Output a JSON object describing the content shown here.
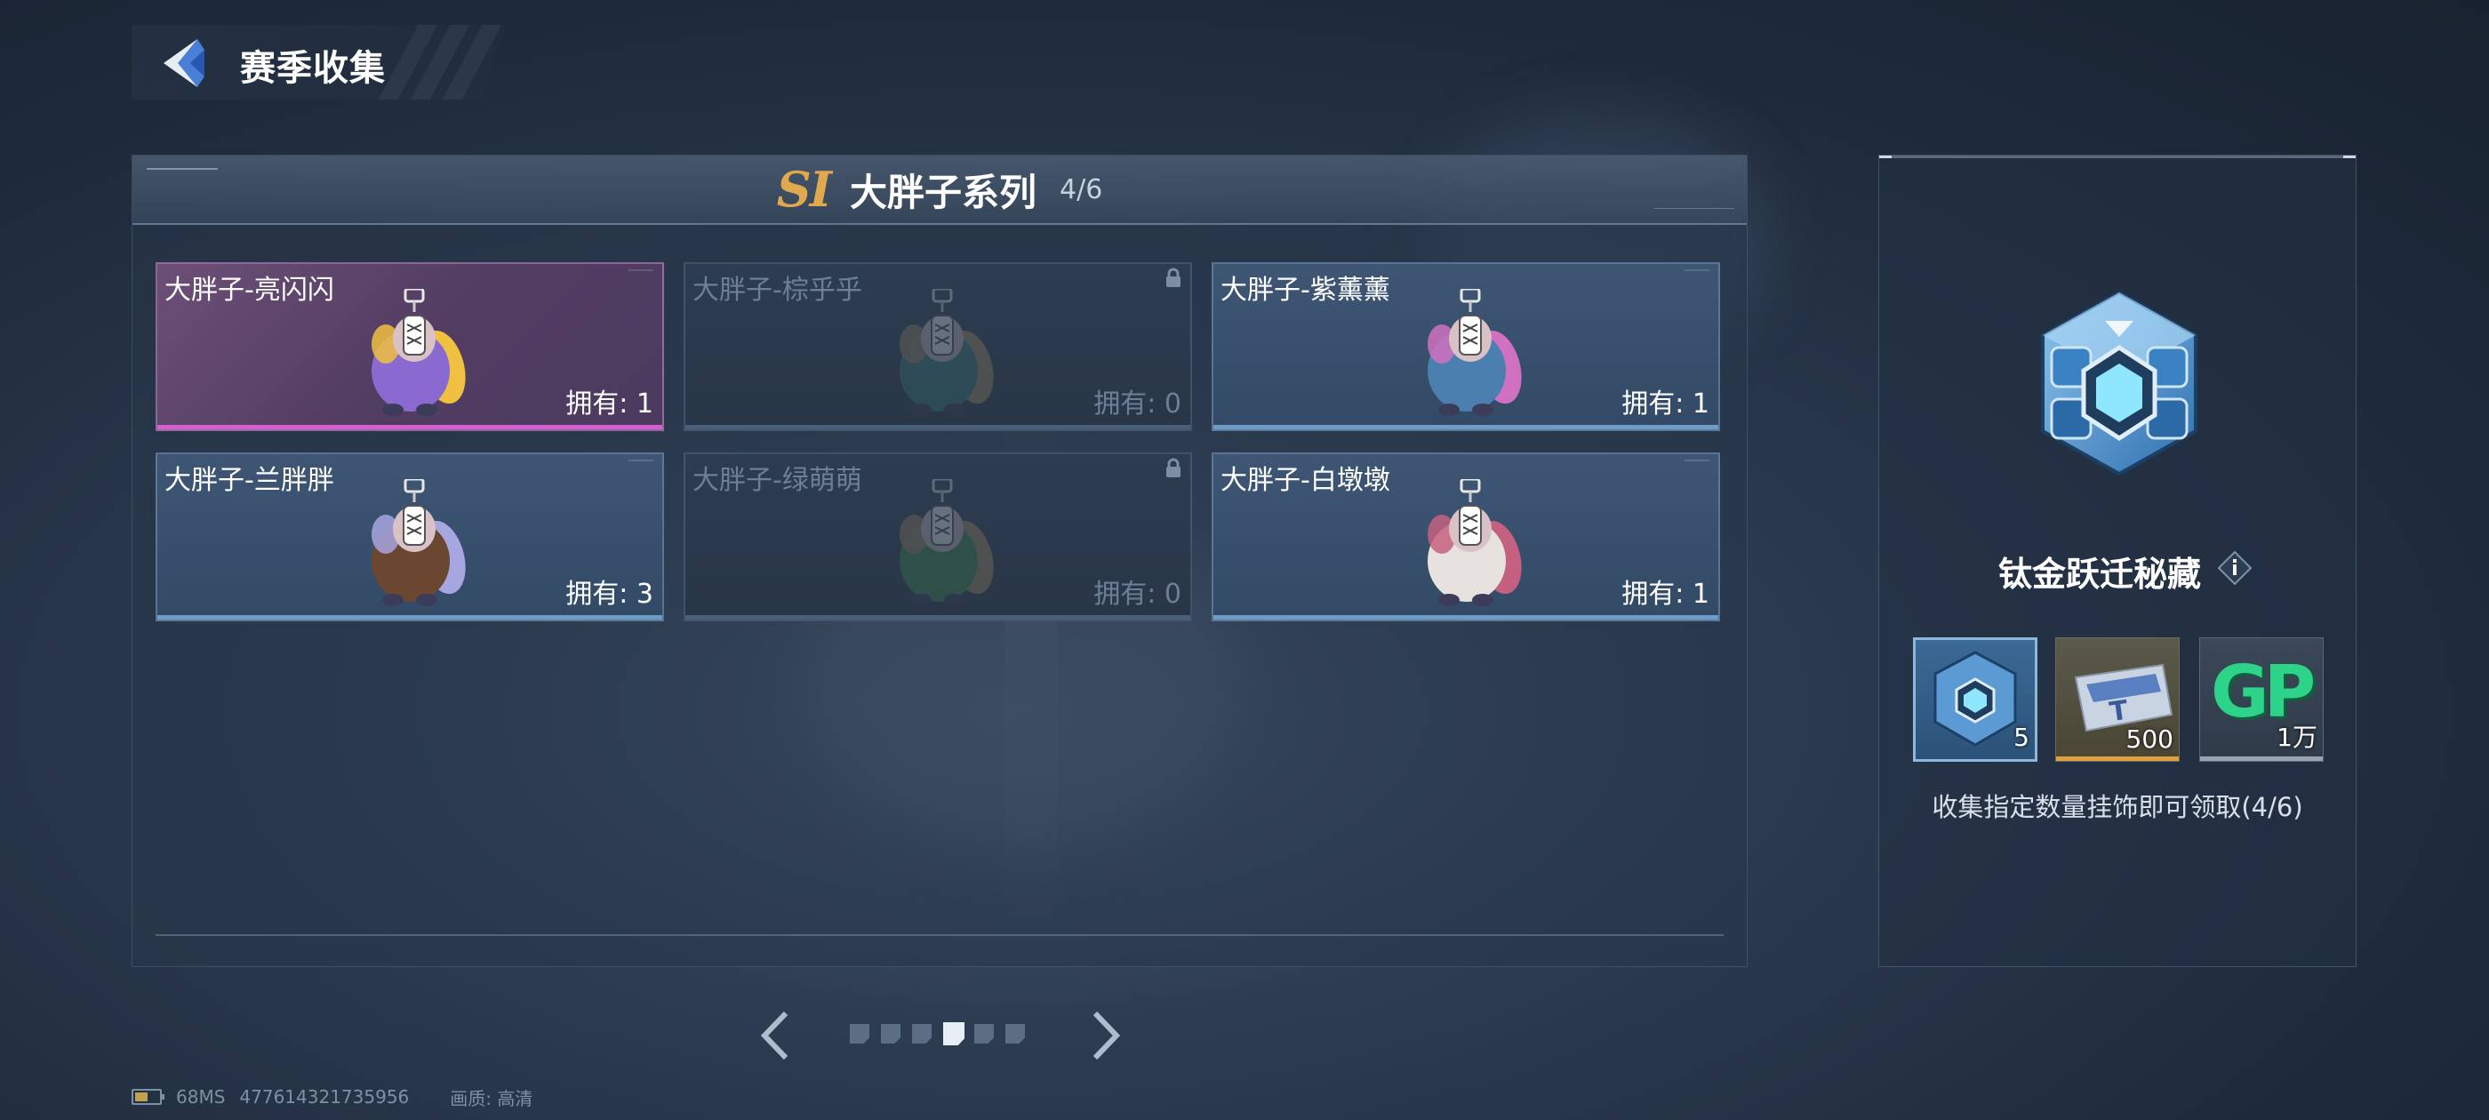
{
  "header": {
    "title": "赛季收集"
  },
  "series": {
    "badge": "SI",
    "name": "大胖子系列",
    "progress": "4/6"
  },
  "items": [
    {
      "name": "大胖子-亮闪闪",
      "owned": "拥有: 1",
      "style": "purple",
      "locked": false,
      "body_color": "#8a6ad0",
      "accent_color": "#f0c040"
    },
    {
      "name": "大胖子-棕乎乎",
      "owned": "拥有: 0",
      "style": "locked",
      "locked": true,
      "body_color": "#3a7f7a",
      "accent_color": "#b09060"
    },
    {
      "name": "大胖子-紫薰薰",
      "owned": "拥有: 1",
      "style": "blue",
      "locked": false,
      "body_color": "#4a7fb0",
      "accent_color": "#d070c0"
    },
    {
      "name": "大胖子-兰胖胖",
      "owned": "拥有: 3",
      "style": "blue",
      "locked": false,
      "body_color": "#6b4630",
      "accent_color": "#a6a6e0"
    },
    {
      "name": "大胖子-绿萌萌",
      "owned": "拥有: 0",
      "style": "locked",
      "locked": true,
      "body_color": "#3f8f4a",
      "accent_color": "#b09060"
    },
    {
      "name": "大胖子-白墩墩",
      "owned": "拥有: 1",
      "style": "blue",
      "locked": false,
      "body_color": "#e8e2de",
      "accent_color": "#c46080"
    }
  ],
  "reward": {
    "name": "钛金跃迁秘藏",
    "description": "收集指定数量挂饰即可领取(4/6)",
    "items": [
      {
        "icon": "crate-icon",
        "count": "5",
        "bar_color": "#7fa6cc"
      },
      {
        "icon": "ticket-icon",
        "count": "500",
        "bar_color": "#e0a040"
      },
      {
        "icon": "gp-coin-icon",
        "label": "GP",
        "count": "1万",
        "bar_color": "#9aa5b2"
      }
    ]
  },
  "pagination": {
    "total": 6,
    "active_index": 3
  },
  "status": {
    "ping": "68MS",
    "uid": "477614321735956",
    "quality": "画质: 高清"
  }
}
